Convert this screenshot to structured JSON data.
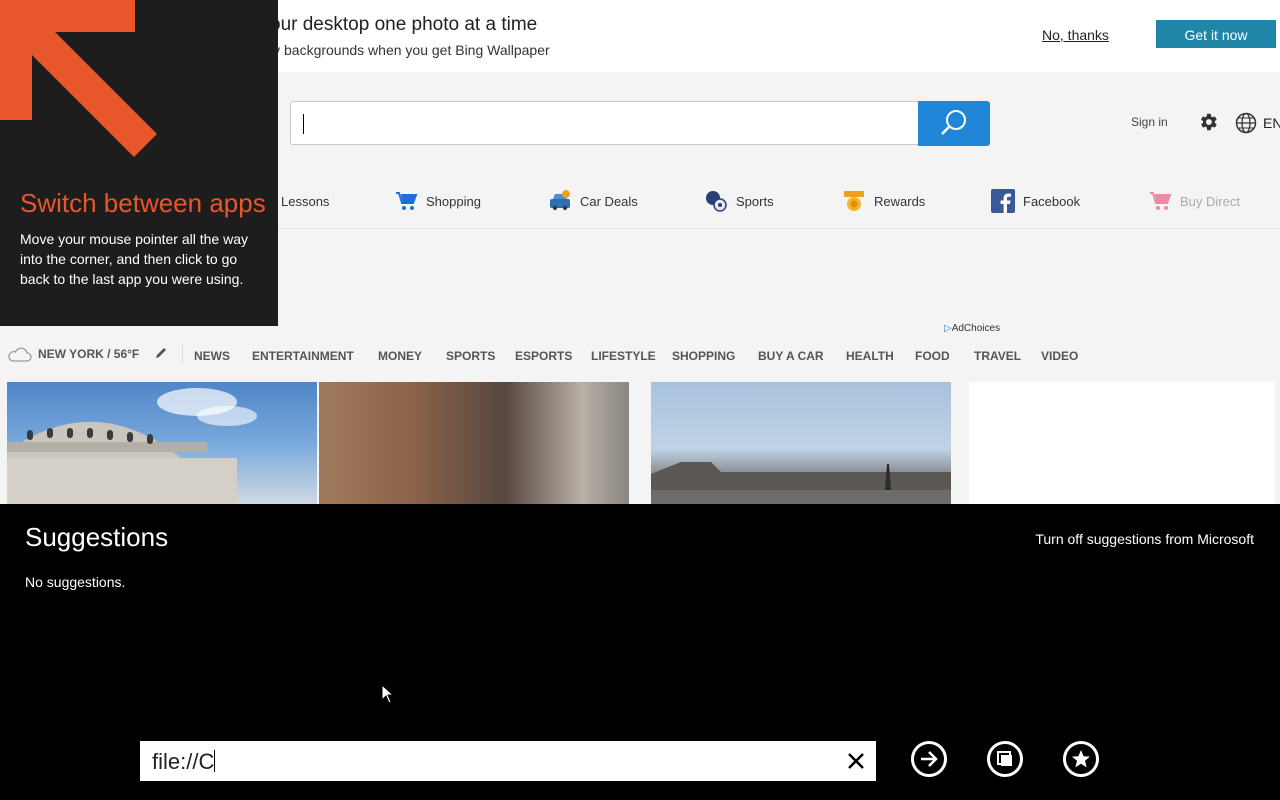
{
  "promo": {
    "title": "our desktop one photo at a time",
    "subtitle": "ly backgrounds when you get Bing Wallpaper",
    "no_thanks": "No, thanks",
    "get_it_now": "Get it now"
  },
  "header": {
    "search_icon": "search-icon",
    "sign_in": "Sign in",
    "settings_icon": "gear-icon",
    "language_icon": "globe-icon",
    "language": "EN"
  },
  "quick_links": [
    {
      "label": "Lessons"
    },
    {
      "label": "Shopping",
      "icon": "shopping-cart-icon"
    },
    {
      "label": "Car Deals",
      "icon": "car-icon"
    },
    {
      "label": "Sports",
      "icon": "sports-ball-icon"
    },
    {
      "label": "Rewards",
      "icon": "rewards-medal-icon"
    },
    {
      "label": "Facebook",
      "icon": "facebook-icon"
    },
    {
      "label": "Buy Direct",
      "icon": "shopping-cart-icon"
    }
  ],
  "ad_choices": "AdChoices",
  "news_nav": {
    "weather": "NEW YORK / 56°F",
    "items": [
      "NEWS",
      "ENTERTAINMENT",
      "MONEY",
      "SPORTS",
      "ESPORTS",
      "LIFESTYLE",
      "SHOPPING",
      "BUY A CAR",
      "HEALTH",
      "FOOD",
      "TRAVEL",
      "VIDEO"
    ]
  },
  "tip": {
    "title": "Switch between apps",
    "body": "Move your mouse pointer all the way into the corner, and then click to go back to the last app you were using."
  },
  "suggestions": {
    "title": "Suggestions",
    "turn_off": "Turn off suggestions from Microsoft",
    "empty": "No suggestions."
  },
  "address_bar": {
    "value": "file://C",
    "clear_icon": "close-icon",
    "go_icon": "arrow-right-icon",
    "tabs_icon": "tabs-icon",
    "favorites_icon": "star-icon"
  },
  "colors": {
    "accent": "#1f86d8",
    "promo_button": "#1f86a7",
    "tip_title": "#e8562b"
  }
}
